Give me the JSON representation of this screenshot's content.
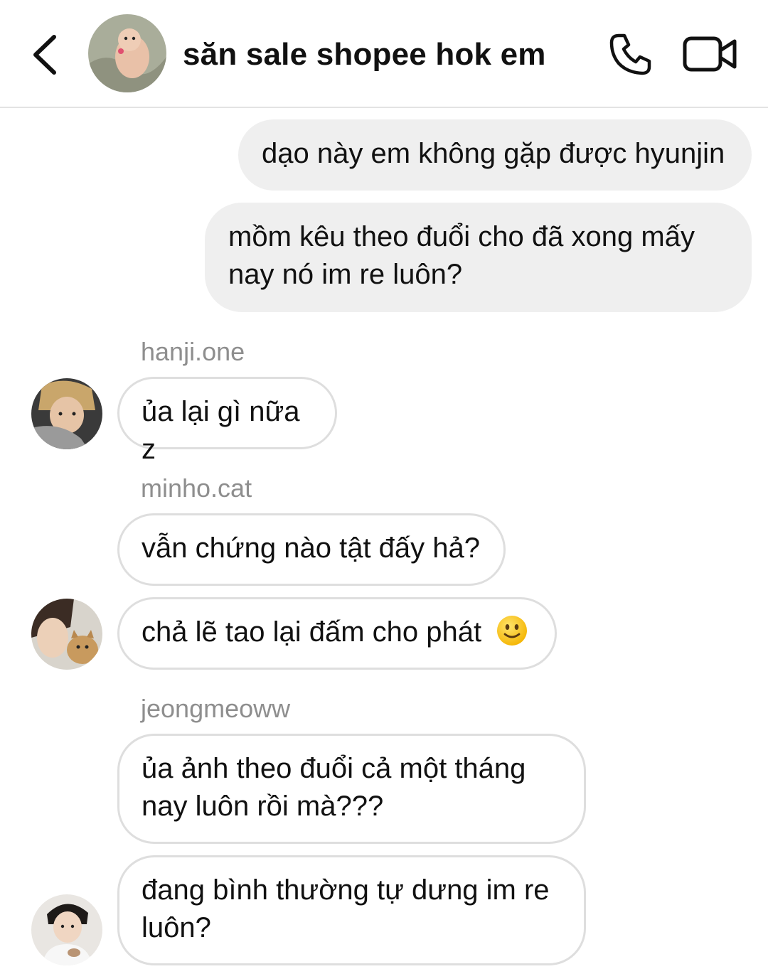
{
  "header": {
    "title": "săn sale shopee hok em",
    "back_icon": "chevron-left-icon",
    "call_icon": "phone-icon",
    "video_icon": "video-camera-icon"
  },
  "messages": [
    {
      "direction": "outgoing",
      "text": "dạo này em không gặp được hyunjin"
    },
    {
      "direction": "outgoing",
      "lines": [
        "mồm kêu theo đuổi cho đã xong mấy",
        "nay nó im re luôn?"
      ]
    },
    {
      "direction": "incoming",
      "sender": "hanji.one",
      "text": "ủa lại gì nữa z"
    },
    {
      "direction": "incoming",
      "sender": "minho.cat",
      "text": "vẫn chứng nào tật đấy hả?"
    },
    {
      "direction": "incoming",
      "sender": "",
      "text": "chả lẽ tao lại đấm cho phát",
      "emoji": "slightly-smiling-face-icon"
    },
    {
      "direction": "incoming",
      "sender": "jeongmeoww",
      "lines": [
        "ủa ảnh theo đuổi cả một tháng",
        "nay luôn rồi mà???"
      ]
    },
    {
      "direction": "incoming",
      "sender": "",
      "lines": [
        "đang bình thường tự dưng im re",
        "luôn?"
      ]
    }
  ],
  "colors": {
    "outgoing_bubble": "#efefef",
    "incoming_border": "#dedede",
    "sender_name": "#8e8e8e"
  }
}
